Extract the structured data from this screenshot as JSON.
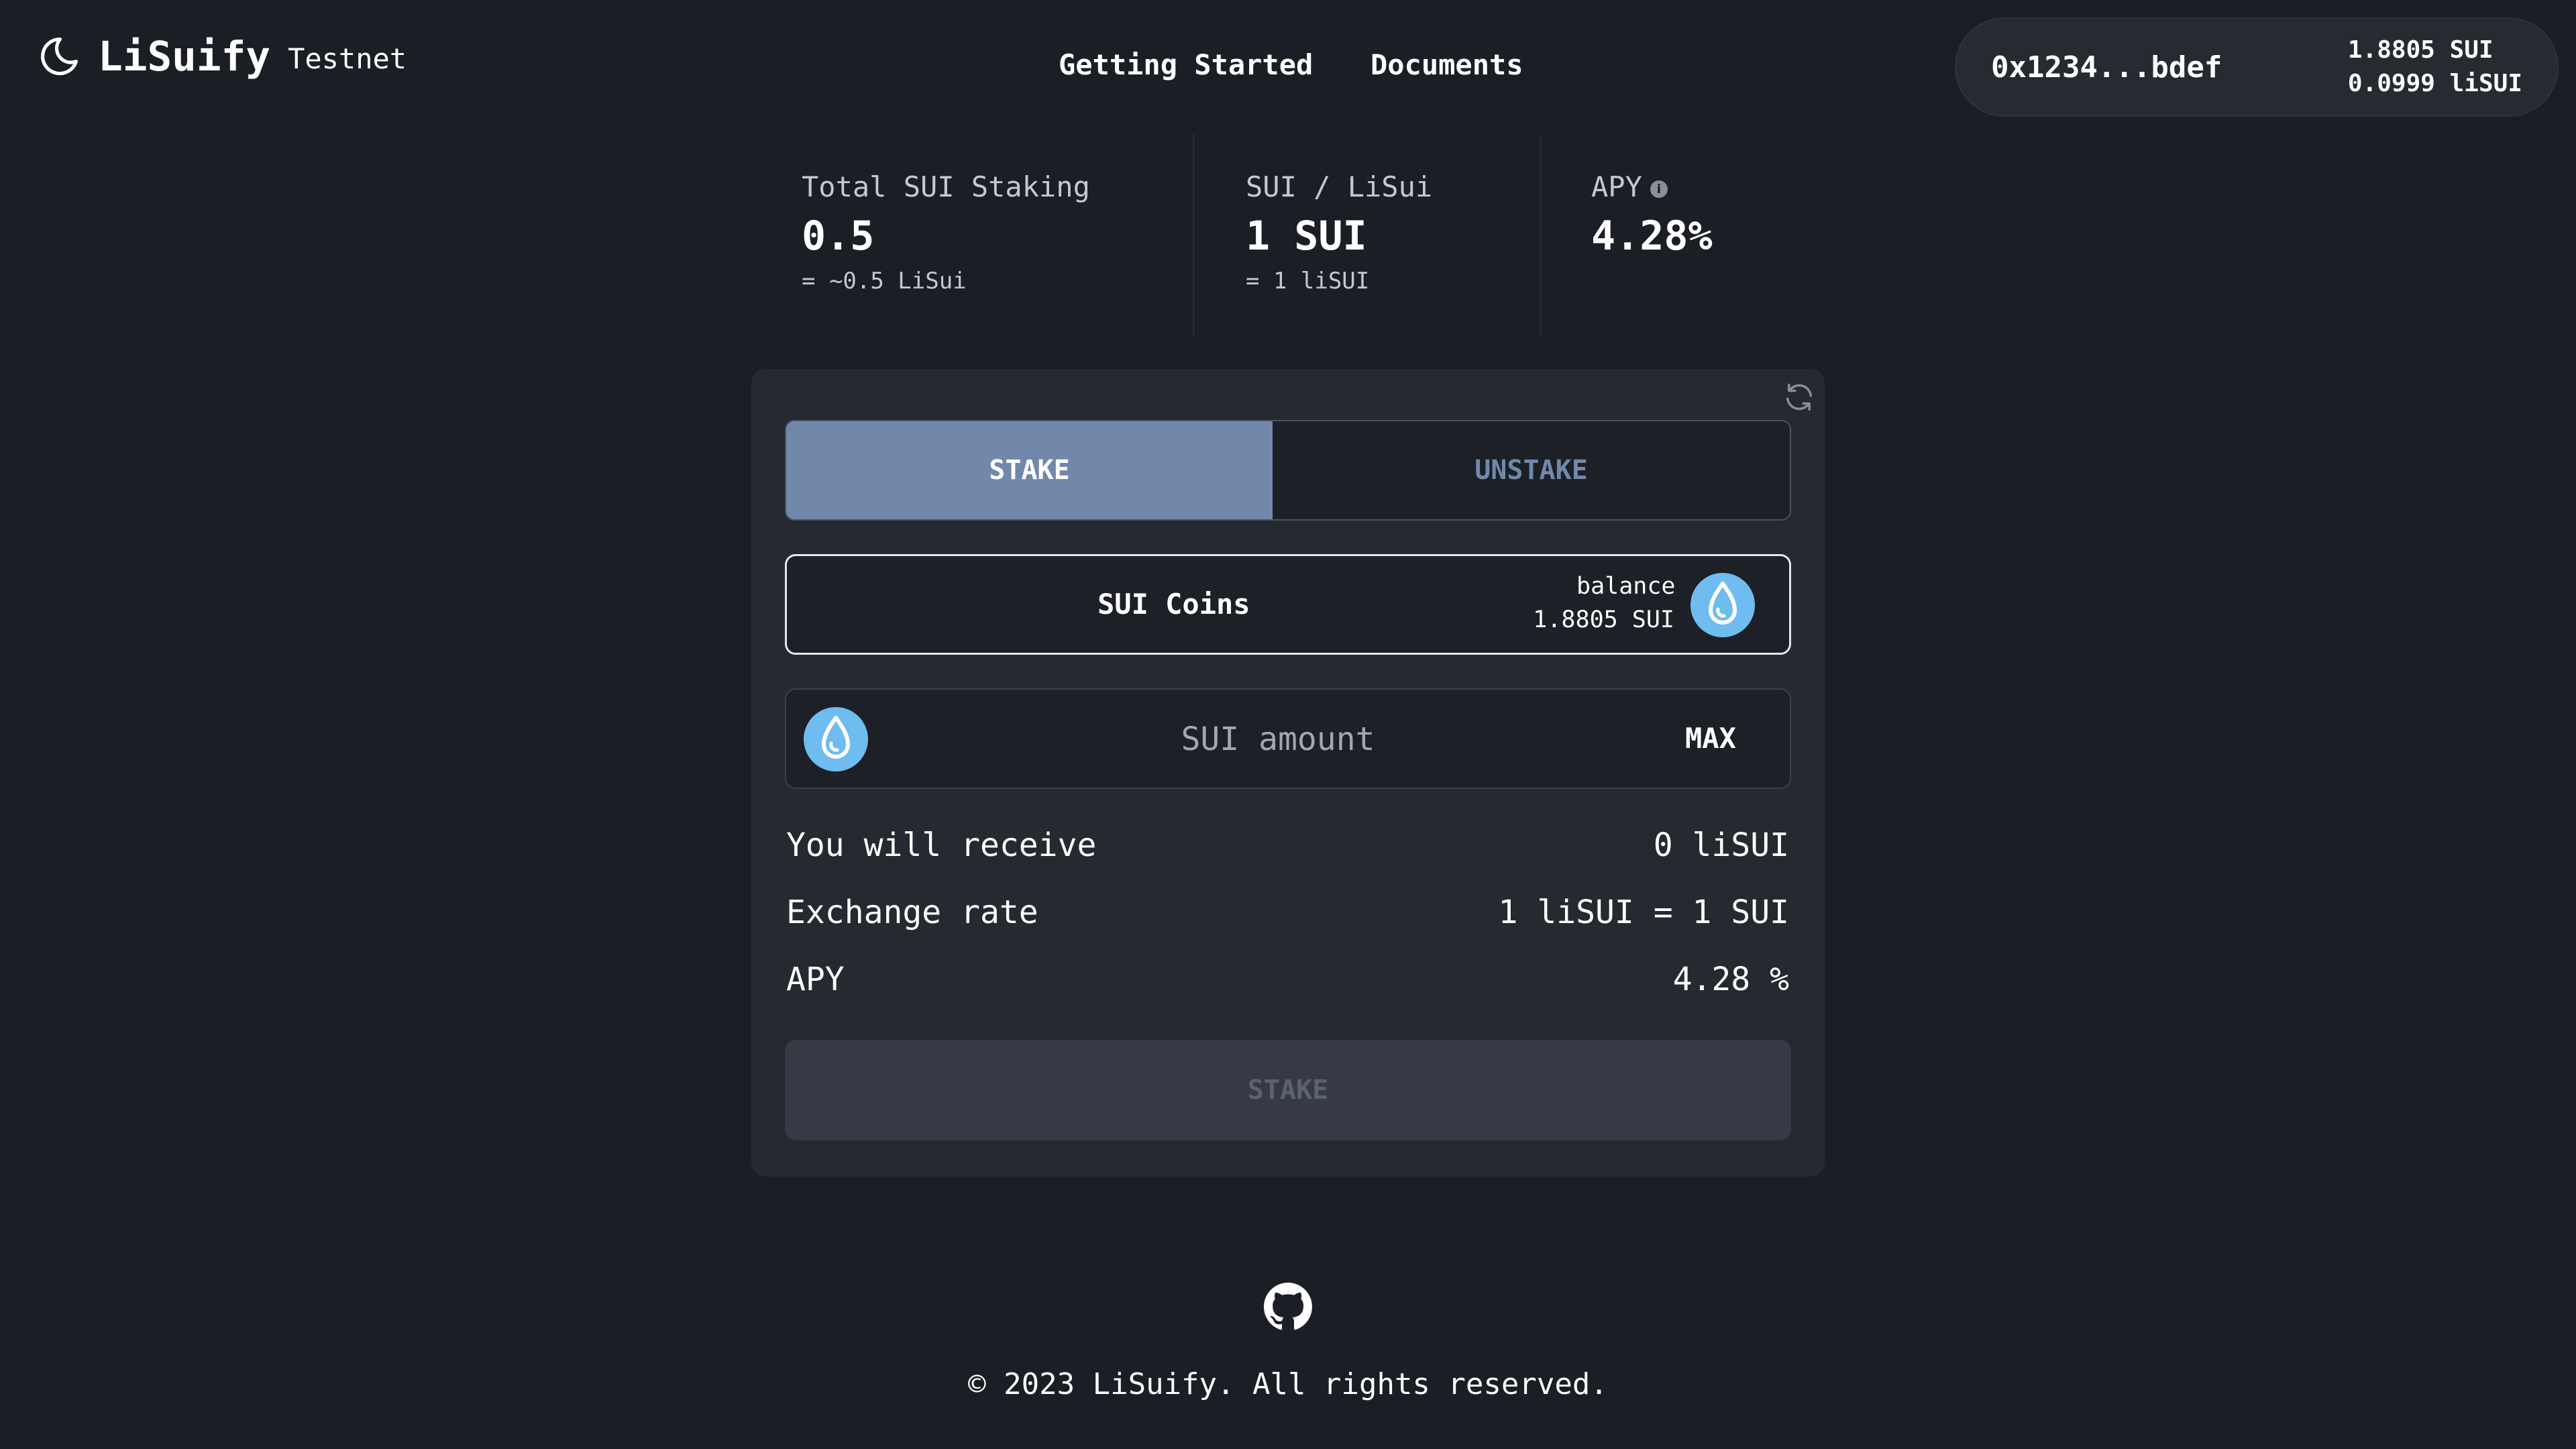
{
  "header": {
    "app_name": "LiSuify",
    "network": "Testnet",
    "nav": [
      "Getting Started",
      "Documents"
    ],
    "wallet": {
      "address": "0x1234...bdef",
      "sui_balance": "1.8805 SUI",
      "lisui_balance": "0.0999 liSUI"
    }
  },
  "stats": [
    {
      "label": "Total SUI Staking",
      "value": "0.5",
      "sub": "= ~0.5 LiSui"
    },
    {
      "label": "SUI / LiSui",
      "value": "1 SUI",
      "sub": "= 1 liSUI"
    },
    {
      "label": "APY",
      "value": "4.28%",
      "sub": ""
    }
  ],
  "card": {
    "tabs": {
      "stake": "STAKE",
      "unstake": "UNSTAKE",
      "active": "stake"
    },
    "coins": {
      "label": "SUI Coins",
      "balance_label": "balance",
      "balance_value": "1.8805 SUI"
    },
    "amount": {
      "placeholder": "SUI amount",
      "value": "",
      "max_label": "MAX"
    },
    "rows": [
      {
        "label": "You will receive",
        "value": "0 liSUI"
      },
      {
        "label": "Exchange rate",
        "value": "1 liSUI = 1 SUI"
      },
      {
        "label": "APY",
        "value": "4.28 %"
      }
    ],
    "submit_label": "STAKE"
  },
  "footer": {
    "copyright": "© 2023 LiSuify. All rights reserved."
  },
  "icons": {
    "logo": "moon-icon",
    "refresh": "refresh-icon",
    "coin": "sui-drop-icon",
    "github": "github-icon",
    "info": "info-icon"
  },
  "colors": {
    "background": "#1b1e25",
    "card": "#252930",
    "accent": "#7188ab",
    "sui_blue": "#6fbcf0",
    "disabled_button": "#353a44"
  }
}
